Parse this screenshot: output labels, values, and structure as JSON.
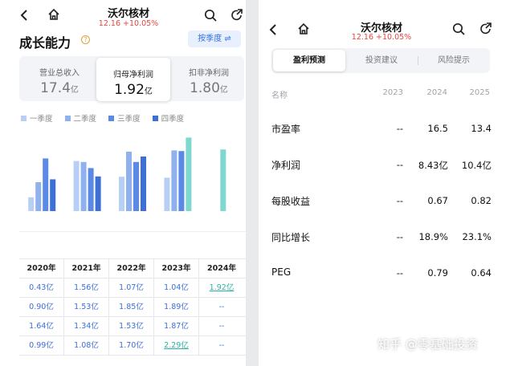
{
  "left": {
    "header": {
      "title": "沃尔核材",
      "subtitle": "12.16 +10.05%"
    },
    "section_title": "成长能力",
    "help_label": "?",
    "quarter_button": "按季度 ⇌",
    "metrics": [
      {
        "label": "营业总收入",
        "value": "17.4",
        "unit": "亿",
        "active": false
      },
      {
        "label": "归母净利润",
        "value": "1.92",
        "unit": "亿",
        "active": true
      },
      {
        "label": "扣非净利润",
        "value": "1.80",
        "unit": "亿",
        "active": false
      }
    ],
    "legend": [
      {
        "name": "一季度",
        "color": "#b7cff4"
      },
      {
        "name": "二季度",
        "color": "#8fb1ee"
      },
      {
        "name": "三季度",
        "color": "#5b89e6"
      },
      {
        "name": "四季度",
        "color": "#3d6fd6"
      }
    ],
    "highlight_color": "#7fd8cf",
    "chart_data": {
      "type": "bar",
      "categories": [
        "2020年",
        "2021年",
        "2022年",
        "2023年",
        "2024年"
      ],
      "series": [
        {
          "name": "一季度",
          "values": [
            0.43,
            1.56,
            1.07,
            1.04,
            1.92
          ]
        },
        {
          "name": "二季度",
          "values": [
            0.9,
            1.53,
            1.85,
            1.89,
            null
          ]
        },
        {
          "name": "三季度",
          "values": [
            1.64,
            1.34,
            1.53,
            1.87,
            null
          ]
        },
        {
          "name": "四季度",
          "values": [
            0.99,
            1.08,
            1.7,
            2.29,
            null
          ]
        }
      ],
      "ylim": [
        0,
        2.4
      ]
    },
    "table": {
      "headers": [
        "2020年",
        "2021年",
        "2022年",
        "2023年",
        "2024年"
      ],
      "rows": [
        [
          "0.43亿",
          "1.56亿",
          "1.07亿",
          "1.04亿",
          "1.92亿"
        ],
        [
          "0.90亿",
          "1.53亿",
          "1.85亿",
          "1.89亿",
          "--"
        ],
        [
          "1.64亿",
          "1.34亿",
          "1.53亿",
          "1.87亿",
          "--"
        ],
        [
          "0.99亿",
          "1.08亿",
          "1.70亿",
          "2.29亿",
          "--"
        ]
      ]
    }
  },
  "right": {
    "header": {
      "title": "沃尔核材",
      "subtitle": "12.16 +10.05%"
    },
    "tabs": [
      {
        "label": "盈利预测",
        "active": true
      },
      {
        "label": "投资建议",
        "active": false
      },
      {
        "label": "风险提示",
        "active": false
      }
    ],
    "columns": [
      "名称",
      "2023",
      "2024",
      "2025"
    ],
    "rows": [
      {
        "name": "市盈率",
        "values": [
          "--",
          "16.5",
          "13.4"
        ]
      },
      {
        "name": "净利润",
        "values": [
          "--",
          "8.43亿",
          "10.4亿"
        ]
      },
      {
        "name": "每股收益",
        "values": [
          "--",
          "0.67",
          "0.82"
        ]
      },
      {
        "name": "同比增长",
        "values": [
          "--",
          "18.9%",
          "23.1%"
        ]
      },
      {
        "name": "PEG",
        "values": [
          "--",
          "0.79",
          "0.64"
        ]
      }
    ]
  },
  "watermark": "知乎 @零基础投资"
}
